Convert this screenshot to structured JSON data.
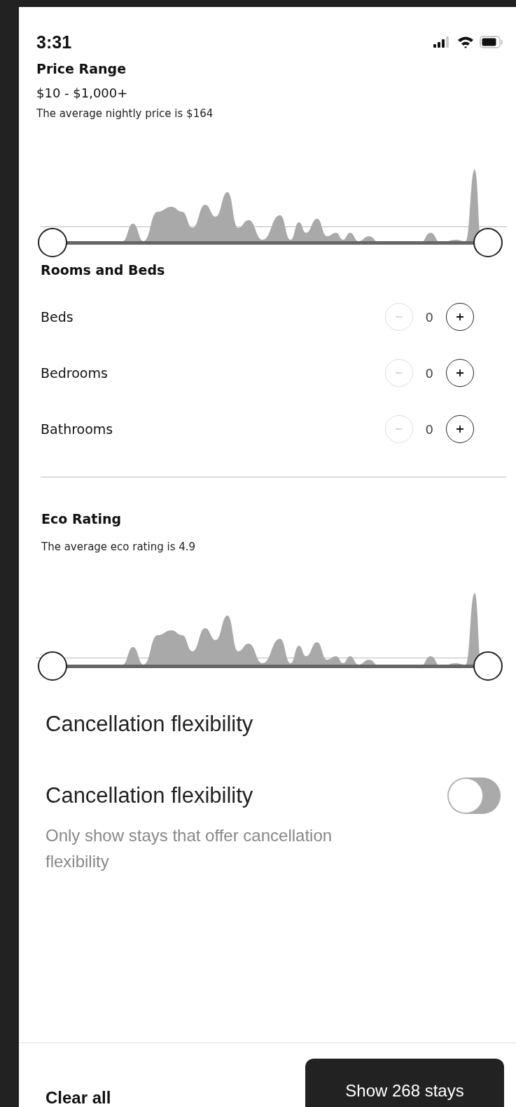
{
  "status_bar": {
    "time": "3:31"
  },
  "price": {
    "title": "Price Range",
    "range": "$10 - $1,000+",
    "note": "The average nightly price is $164",
    "thumbs": [
      {
        "level": 0
      },
      {
        "level": 1
      }
    ]
  },
  "rooms": {
    "title": "Rooms and Beds",
    "rows": [
      {
        "label": "Beds",
        "value": "0",
        "minus_disabled": true,
        "plus_disabled": false
      },
      {
        "label": "Bedrooms",
        "value": "0",
        "minus_disabled": true,
        "plus_disabled": false
      },
      {
        "label": "Bathrooms",
        "value": "0",
        "minus_disabled": true,
        "plus_disabled": false
      }
    ]
  },
  "eco": {
    "title": "Eco Rating",
    "note": "The average eco rating is 4.9",
    "thumbs": [
      {
        "level": 0
      },
      {
        "level": 1
      }
    ]
  },
  "cancellation": {
    "title": "Cancellation flexibility",
    "option": {
      "label": "Cancellation flexibility",
      "description": "Only show stays that offer cancellation flexibility",
      "on": false
    }
  },
  "footer": {
    "clear": "Clear all",
    "show": "Show 268 stays"
  }
}
